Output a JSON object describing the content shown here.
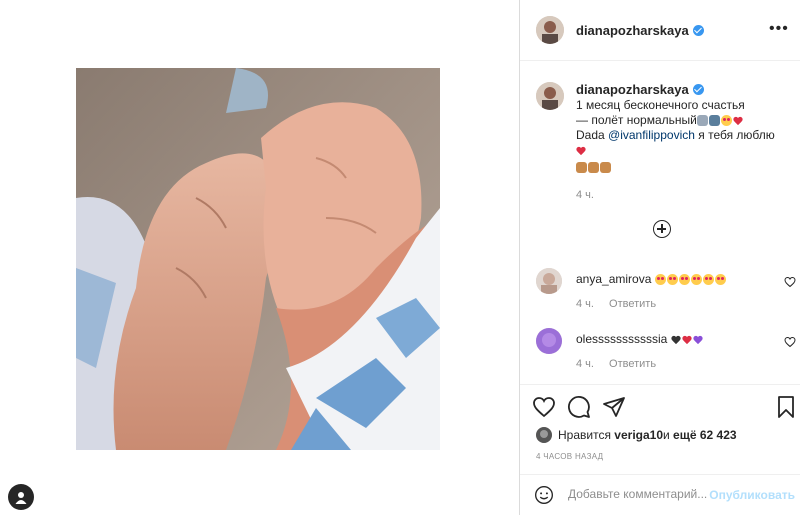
{
  "post": {
    "username": "dianapozharskaya",
    "verified": true,
    "caption_lines": [
      "1 месяц бесконечного счастья",
      "— полёт нормальный"
    ],
    "caption_dada_prefix": "Dada ",
    "caption_mention": "@ivanfilippovich",
    "caption_dada_suffix": " я тебя люблю",
    "caption_time": "4 ч."
  },
  "comments": [
    {
      "username": "anya_amirova",
      "text": "",
      "time": "4 ч.",
      "reply_label": "Ответить"
    },
    {
      "username": "olesssssssssssia",
      "text": "",
      "time": "4 ч.",
      "reply_label": "Ответить"
    }
  ],
  "likes": {
    "prefix": "Нравится ",
    "liker": "veriga10",
    "middle": " и ",
    "others": "ещё 62 423"
  },
  "date_label": "4 часов назад",
  "comment_box": {
    "placeholder": "Добавьте комментарий...",
    "publish_label": "Опубликовать"
  },
  "icons": {
    "like": "heart-icon",
    "comment": "comment-icon",
    "share": "send-icon",
    "save": "bookmark-icon",
    "more": "more-icon",
    "load_more": "plus-circle-icon",
    "emoji": "emoji-icon",
    "profile": "profile-icon"
  },
  "colors": {
    "verified": "#3897f0",
    "link": "#00376b",
    "muted": "#8e8e8e",
    "publish_disabled": "#b2dffc"
  }
}
